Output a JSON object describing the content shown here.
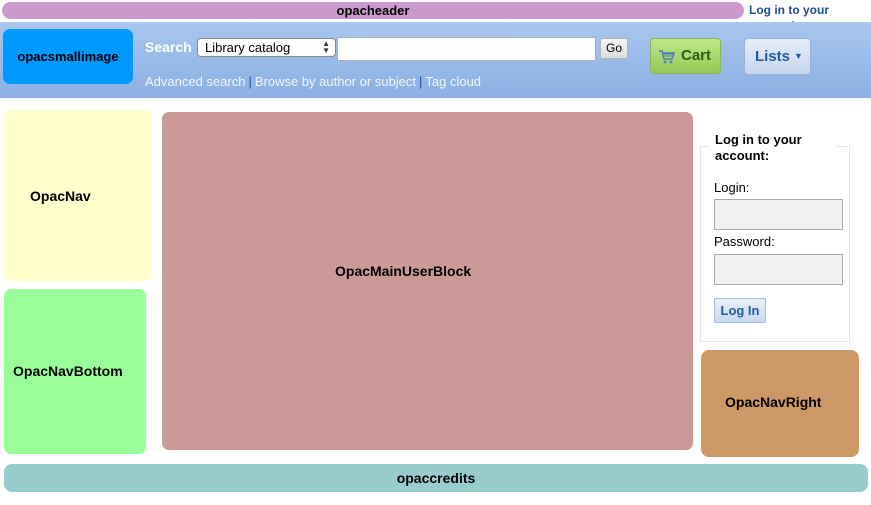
{
  "header": {
    "label": "opacheader",
    "login_link": "Log in to your account"
  },
  "masthead": {
    "small_image_label": "opacsmallimage",
    "search_label": "Search",
    "search_scope_selected": "Library catalog",
    "search_query": "",
    "go_label": "Go",
    "cart_label": "Cart",
    "lists_label": "Lists",
    "links": [
      "Advanced search",
      "Browse by author or subject",
      "Tag cloud"
    ],
    "link_separator": "|"
  },
  "regions": {
    "opac_nav": "OpacNav",
    "opac_nav_bottom": "OpacNavBottom",
    "opac_main_user_block": "OpacMainUserBlock",
    "opac_nav_right": "OpacNavRight",
    "opac_credits": "opaccredits"
  },
  "login": {
    "title": "Log in to your account:",
    "login_label": "Login:",
    "login_value": "",
    "password_label": "Password:",
    "password_value": "",
    "button_label": "Log In"
  },
  "colors": {
    "header": "#cc99cc",
    "masthead": "#8cb0e3",
    "small_image": "#0099ff",
    "opac_nav": "#ffffcc",
    "opac_nav_bottom": "#99ff99",
    "main_user_block": "#cc9999",
    "opac_nav_right": "#cc9966",
    "credits": "#99cccc",
    "link": "#1d4e94"
  },
  "icons": {
    "cart": "cart-icon",
    "lists_caret": "caret-down-icon",
    "select_arrows": "select-arrows-icon"
  }
}
